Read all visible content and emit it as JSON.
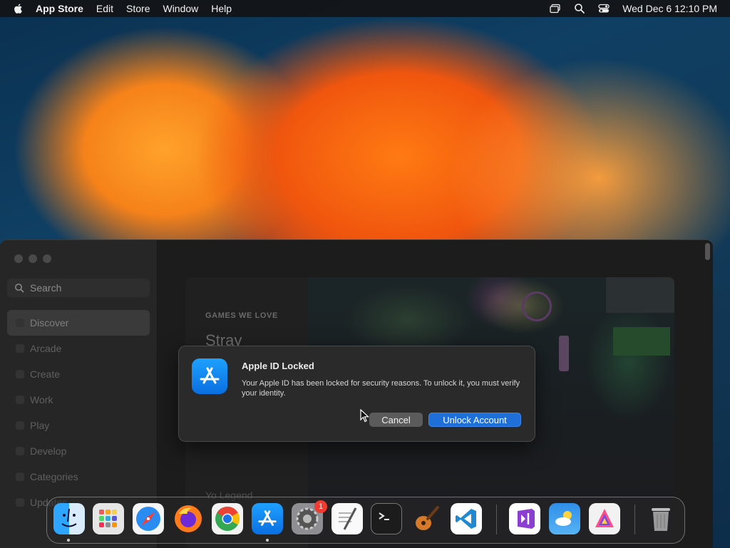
{
  "menubar": {
    "app_name": "App Store",
    "menus": [
      "Edit",
      "Store",
      "Window",
      "Help"
    ],
    "clock": "Wed Dec 6  12:10 PM"
  },
  "sidebar": {
    "search_placeholder": "Search",
    "items": [
      {
        "label": "Discover"
      },
      {
        "label": "Arcade"
      },
      {
        "label": "Create"
      },
      {
        "label": "Work"
      },
      {
        "label": "Play"
      },
      {
        "label": "Develop"
      },
      {
        "label": "Categories"
      },
      {
        "label": "Updates"
      }
    ]
  },
  "hero": {
    "label": "GAMES WE LOVE",
    "title": "Stray",
    "subtitle": "Yo Legend"
  },
  "dialog": {
    "title": "Apple ID Locked",
    "message": "Your Apple ID has been locked for security reasons. To unlock it, you must verify your identity.",
    "cancel_label": "Cancel",
    "confirm_label": "Unlock Account"
  },
  "dock": {
    "items": [
      {
        "name": "finder-icon"
      },
      {
        "name": "launchpad-icon"
      },
      {
        "name": "safari-icon"
      },
      {
        "name": "firefox-icon"
      },
      {
        "name": "chrome-icon"
      },
      {
        "name": "app-store-icon"
      },
      {
        "name": "system-settings-icon",
        "badge": "1"
      },
      {
        "name": "textedit-icon"
      },
      {
        "name": "terminal-icon"
      },
      {
        "name": "garageband-icon"
      },
      {
        "name": "vscode-icon"
      },
      {
        "name": "visual-studio-icon"
      },
      {
        "name": "weather-icon"
      },
      {
        "name": "affinity-icon"
      },
      {
        "name": "trash-icon"
      }
    ]
  },
  "colors": {
    "accent": "#1f6fd8",
    "badge": "#f23b30"
  }
}
